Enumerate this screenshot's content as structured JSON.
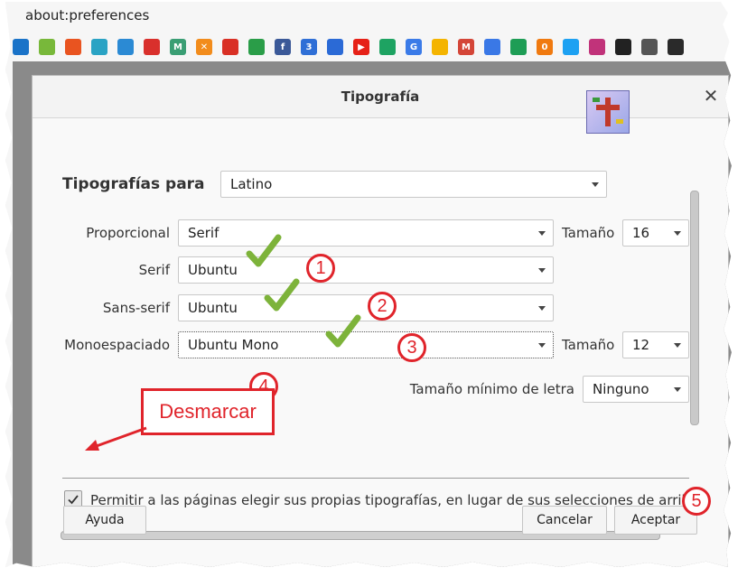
{
  "browser": {
    "url": "about:preferences",
    "bookmark_icons": [
      {
        "icon": "firefox-bookmark-icon",
        "color": "#1a73c8",
        "glyph": ""
      },
      {
        "icon": "android-icon",
        "color": "#78b83a",
        "glyph": ""
      },
      {
        "icon": "ubuntu-icon",
        "color": "#e95420",
        "glyph": ""
      },
      {
        "icon": "settings-bookmark-icon",
        "color": "#2aa3c4",
        "glyph": ""
      },
      {
        "icon": "blue-swirl-icon",
        "color": "#2b8ad4",
        "glyph": ""
      },
      {
        "icon": "red-grid-icon",
        "color": "#d9302c",
        "glyph": ""
      },
      {
        "icon": "m-bookmark-icon",
        "color": "#3a9e74",
        "glyph": "M"
      },
      {
        "icon": "orange-x-icon",
        "color": "#f28c1c",
        "glyph": "✕"
      },
      {
        "icon": "red-bookmark-icon",
        "color": "#d93025",
        "glyph": ""
      },
      {
        "icon": "whatsapp-icon",
        "color": "#2a9d48",
        "glyph": ""
      },
      {
        "icon": "facebook-icon",
        "color": "#3b5998",
        "glyph": "f"
      },
      {
        "icon": "calendar-icon",
        "color": "#2f6fd6",
        "glyph": "3"
      },
      {
        "icon": "contacts-icon",
        "color": "#2b6ad6",
        "glyph": ""
      },
      {
        "icon": "youtube-icon",
        "color": "#e62117",
        "glyph": "▶"
      },
      {
        "icon": "google-drive-icon",
        "color": "#1ea362",
        "glyph": ""
      },
      {
        "icon": "google-translate-icon",
        "color": "#3b7be8",
        "glyph": "G"
      },
      {
        "icon": "keep-icon",
        "color": "#f4b400",
        "glyph": ""
      },
      {
        "icon": "gmail-icon",
        "color": "#d44638",
        "glyph": "M"
      },
      {
        "icon": "docs-icon",
        "color": "#3a78e6",
        "glyph": ""
      },
      {
        "icon": "sheets-icon",
        "color": "#1e9d55",
        "glyph": ""
      },
      {
        "icon": "zero-icon",
        "color": "#f07a10",
        "glyph": "0"
      },
      {
        "icon": "twitter-icon",
        "color": "#1da1f2",
        "glyph": ""
      },
      {
        "icon": "instagram-icon",
        "color": "#c1337a",
        "glyph": ""
      },
      {
        "icon": "spotify-icon",
        "color": "#222222",
        "glyph": ""
      },
      {
        "icon": "globe-icon",
        "color": "#555555",
        "glyph": ""
      },
      {
        "icon": "dark-circle-icon",
        "color": "#2a2a2a",
        "glyph": ""
      }
    ]
  },
  "dialog": {
    "title": "Tipografía",
    "fonts_for_label": "Tipografías para",
    "fonts_for_value": "Latino",
    "proportional_label": "Proporcional",
    "proportional_value": "Serif",
    "size_label": "Tamaño",
    "proportional_size": "16",
    "serif_label": "Serif",
    "serif_value": "Ubuntu",
    "sans_label": "Sans-serif",
    "sans_value": "Ubuntu",
    "mono_label": "Monoespaciado",
    "mono_value": "Ubuntu Mono",
    "mono_size_label": "Tamaño",
    "mono_size": "12",
    "min_size_label": "Tamaño mínimo de letra",
    "min_size_value": "Ninguno",
    "allow_fonts_label": "Permitir a las páginas elegir sus propias tipografías, en lugar de sus selecciones de arriba",
    "allow_fonts_checked": true,
    "help_button": "Ayuda",
    "cancel_button": "Cancelar",
    "accept_button": "Aceptar"
  },
  "annotations": {
    "badges": [
      "1",
      "2",
      "3",
      "4",
      "5"
    ],
    "callout": "Desmarcar",
    "color": "#e0242b",
    "check_color": "#7db33a"
  }
}
